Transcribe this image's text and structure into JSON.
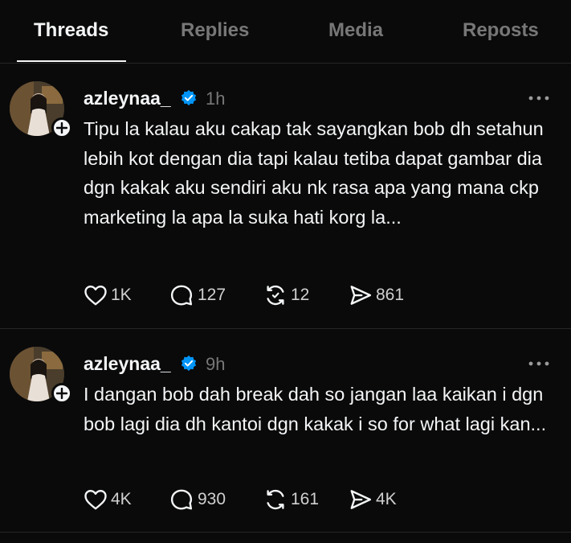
{
  "tabs": [
    {
      "label": "Threads",
      "active": true
    },
    {
      "label": "Replies",
      "active": false
    },
    {
      "label": "Media",
      "active": false
    },
    {
      "label": "Reposts",
      "active": false
    }
  ],
  "posts": [
    {
      "username": "azleynaa_",
      "verified": true,
      "time": "1h",
      "text": "Tipu la kalau aku cakap tak sayangkan bob dh setahun lebih kot dengan dia tapi kalau tetiba dapat gambar dia dgn kakak aku sendiri aku nk rasa apa yang mana ckp marketing la apa la suka hati korg la...",
      "likes": "1K",
      "replies": "127",
      "reposts": "12",
      "shares": "861"
    },
    {
      "username": "azleynaa_",
      "verified": true,
      "time": "9h",
      "text": "I dangan bob dah break dah so jangan laa kaikan i dgn bob lagi dia dh kantoi dgn kakak i so for what lagi kan...",
      "likes": "4K",
      "replies": "930",
      "reposts": "161",
      "shares": "4K"
    }
  ],
  "colors": {
    "background": "#0a0a0a",
    "text": "#f3f5f7",
    "muted": "#777777",
    "verified": "#0095f6",
    "divider": "#262626"
  },
  "icons": [
    "heart-icon",
    "comment-icon",
    "repost-icon",
    "share-icon",
    "verified-badge-icon",
    "more-options-icon",
    "follow-plus-icon"
  ]
}
